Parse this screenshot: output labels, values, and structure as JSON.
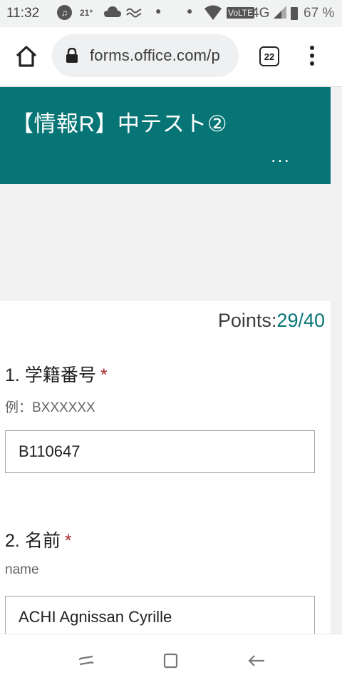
{
  "status_bar": {
    "time": "11:32",
    "temperature": "21°",
    "network": "4G",
    "volte": "VoLTE",
    "battery": "67 %",
    "icons": [
      "music-icon",
      "cloud-icon",
      "wave-icon",
      "wifi-icon",
      "signal-icon",
      "battery-icon"
    ]
  },
  "browser": {
    "url": "forms.office.com/p",
    "tab_count": "22",
    "icons": [
      "home-icon",
      "lock-icon",
      "tabs-icon",
      "overflow-menu-icon"
    ]
  },
  "form": {
    "title": "【情報R】中テスト②",
    "more_label": "...",
    "points_label": "Points:",
    "points_value": "29/40",
    "accent_color": "#077575",
    "required_color": "#a4262c",
    "questions": [
      {
        "number": "1.",
        "title": "学籍番号",
        "required_mark": "*",
        "subtitle": "例：BXXXXXX",
        "answer": "B110647"
      },
      {
        "number": "2.",
        "title": "名前",
        "required_mark": "*",
        "subtitle": "name",
        "answer": "ACHI Agnissan Cyrille"
      }
    ]
  },
  "nav_bar": {
    "icons": [
      "recent-apps-icon",
      "home-square-icon",
      "back-arrow-icon"
    ]
  }
}
